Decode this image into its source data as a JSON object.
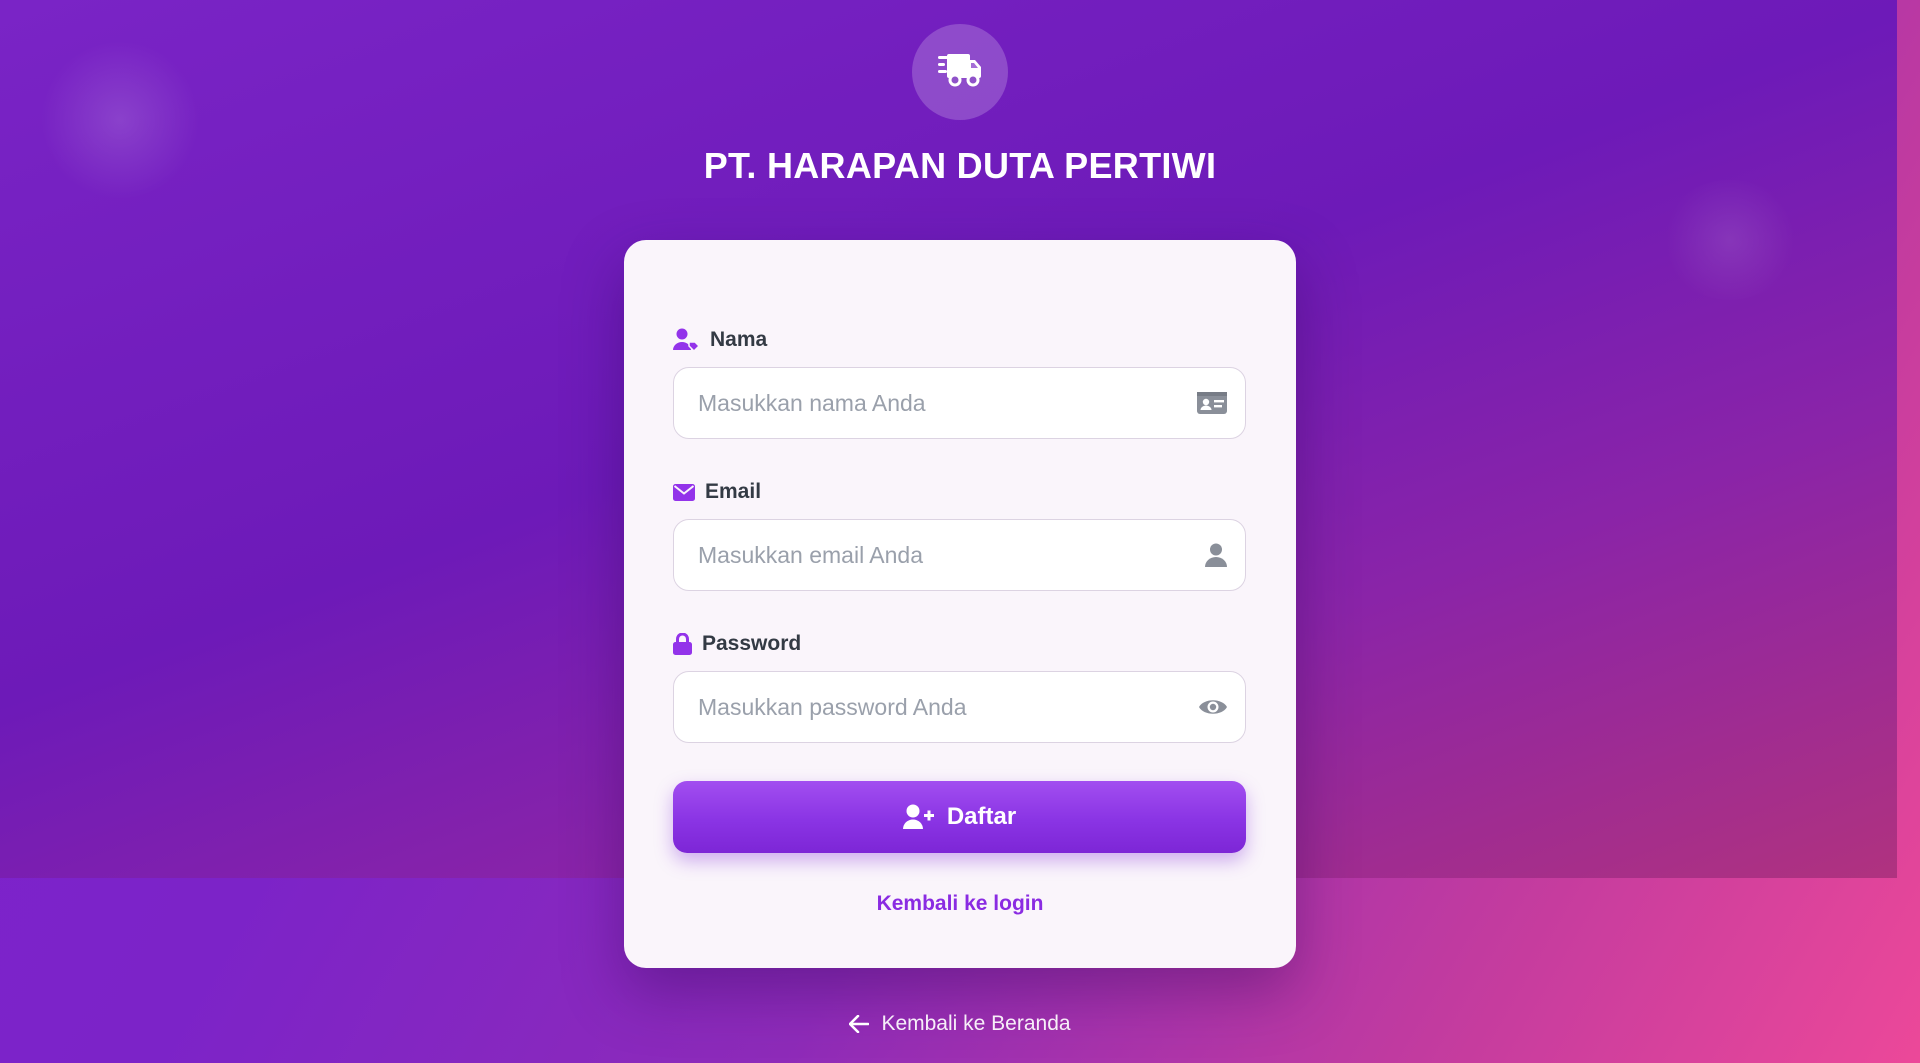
{
  "brand": {
    "title": "PT. HARAPAN DUTA PERTIWI",
    "logo_icon": "delivery-truck-icon"
  },
  "form": {
    "name": {
      "label": "Nama",
      "label_icon": "user-tag-icon",
      "placeholder": "Masukkan nama Anda",
      "value": "",
      "trail_icon": "id-card-icon"
    },
    "email": {
      "label": "Email",
      "label_icon": "envelope-icon",
      "placeholder": "Masukkan email Anda",
      "value": "",
      "trail_icon": "user-icon"
    },
    "password": {
      "label": "Password",
      "label_icon": "lock-icon",
      "placeholder": "Masukkan password Anda",
      "value": "",
      "trail_icon": "eye-icon"
    },
    "submit_label": "Daftar",
    "submit_icon": "user-plus-icon",
    "login_link": "Kembali ke login"
  },
  "footer": {
    "home_link": "Kembali ke Beranda",
    "home_icon": "arrow-left-icon"
  },
  "colors": {
    "accent": "#8a2be2",
    "card_bg": "#faf5fb",
    "gradient_start": "#7e22ce",
    "gradient_end": "#ec4899"
  }
}
